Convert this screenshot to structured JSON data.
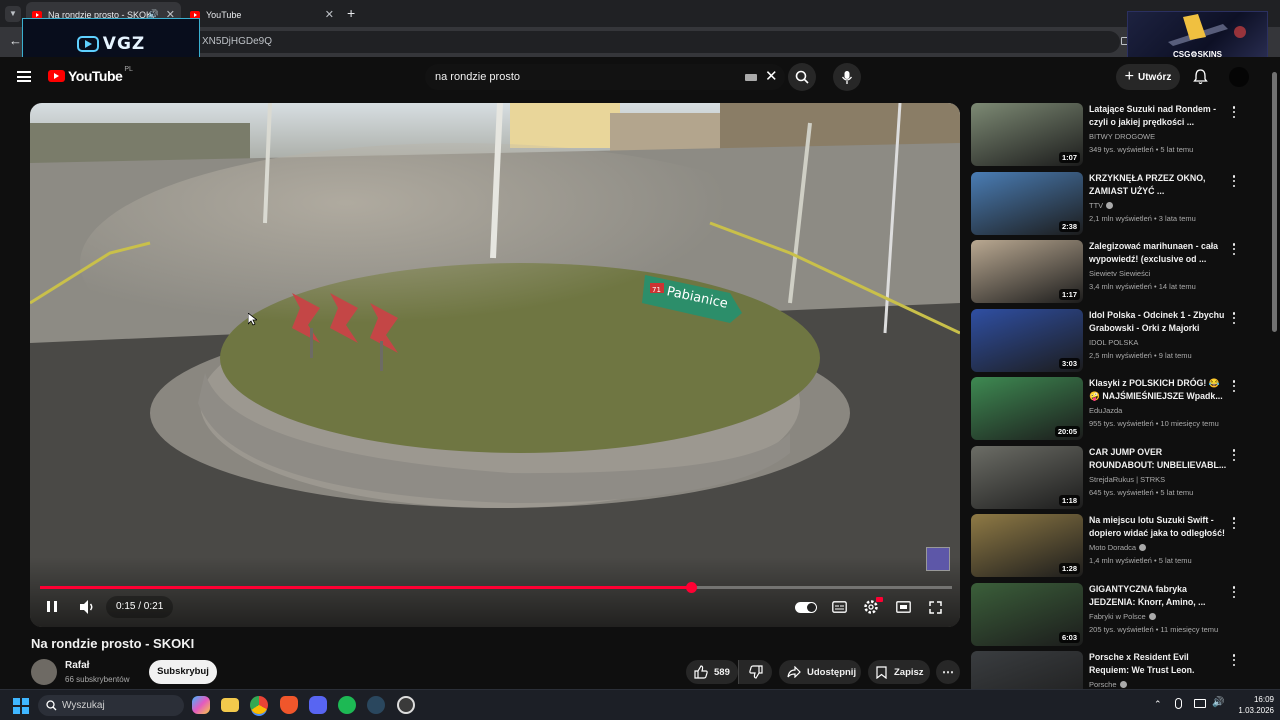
{
  "browser": {
    "tabs": [
      {
        "label": "Na rondzie prosto - SKOKI",
        "active": true
      },
      {
        "label": "YouTube",
        "active": false
      }
    ],
    "url_fragment": "XN5DjHGDe9Q"
  },
  "overlays": {
    "vgz_logo": "VGZ",
    "csgo_logo": "CSG⚙SKINS"
  },
  "header": {
    "logo": "YouTube",
    "logo_cc": "PL",
    "search_value": "na rondzie prosto",
    "create_label": "Utwórz"
  },
  "player": {
    "time": "0:15 / 0:21",
    "progress": 0.714,
    "sign_text": "Pabianice",
    "sign_number": "71"
  },
  "video": {
    "title": "Na rondzie prosto - SKOKI",
    "channel": "Rafał",
    "subscribers": "66 subskrybentów",
    "subscribe_label": "Subskrybuj",
    "likes": "589",
    "share_label": "Udostępnij",
    "save_label": "Zapisz"
  },
  "recommendations": [
    {
      "title": "Latające Suzuki nad Rondem - czyli o jakiej prędkości ...",
      "channel": "BITWY DROGOWE",
      "verified": false,
      "meta": "349 tys. wyświetleń • 5 lat temu",
      "duration": "1:07",
      "thumb": "#7d8a74"
    },
    {
      "title": "KRZYKNĘŁA PRZEZ OKNO, ZAMIAST UŻYĆ ...",
      "channel": "TTV",
      "verified": true,
      "meta": "2,1 mln wyświetleń • 3 lata temu",
      "duration": "2:38",
      "thumb": "#4a7db5"
    },
    {
      "title": "Zalegizować marihunaen - cała wypowiedź! (exclusive od ...",
      "channel": "Siewietv Siewieści",
      "verified": false,
      "meta": "3,4 mln wyświetleń • 14 lat temu",
      "duration": "1:17",
      "thumb": "#b9a891"
    },
    {
      "title": "Idol Polska - Odcinek 1 - Zbychu Grabowski - Orki z Majorki",
      "channel": "IDOL POLSKA",
      "verified": false,
      "meta": "2,5 mln wyświetleń • 9 lat temu",
      "duration": "3:03",
      "thumb": "#2f4fa3"
    },
    {
      "title": "Klasyki z POLSKICH DRÓG! 😂 🤪 NAJŚMIEŚNIEJSZE Wpadk...",
      "channel": "EduJazda",
      "verified": false,
      "meta": "955 tys. wyświetleń • 10 miesięcy temu",
      "duration": "20:05",
      "thumb": "#3e8a52"
    },
    {
      "title": "CAR JUMP OVER ROUNDABOUT: UNBELIEVABL...",
      "channel": "StrejdaRukus | STRKS",
      "verified": false,
      "meta": "645 tys. wyświetleń • 5 lat temu",
      "duration": "1:18",
      "thumb": "#6c6d66"
    },
    {
      "title": "Na miejscu lotu Suzuki Swift - dopiero widać jaka to odległość!",
      "channel": "Moto Doradca",
      "verified": true,
      "meta": "1,4 mln wyświetleń • 5 lat temu",
      "duration": "1:28",
      "thumb": "#8f7a45"
    },
    {
      "title": "GIGANTYCZNA fabryka JEDZENIA: Knorr, Amino, ...",
      "channel": "Fabryki w Polsce",
      "verified": true,
      "meta": "205 tys. wyświetleń • 11 miesięcy temu",
      "duration": "6:03",
      "thumb": "#3b5f3a"
    },
    {
      "title": "Porsche x Resident Evil Requiem: We Trust Leon.",
      "channel": "Porsche",
      "verified": true,
      "meta": "",
      "duration": "",
      "thumb": "#3a3d40"
    }
  ],
  "taskbar": {
    "search_placeholder": "Wyszukaj",
    "time": "16:09",
    "date": "1.03.2026"
  }
}
